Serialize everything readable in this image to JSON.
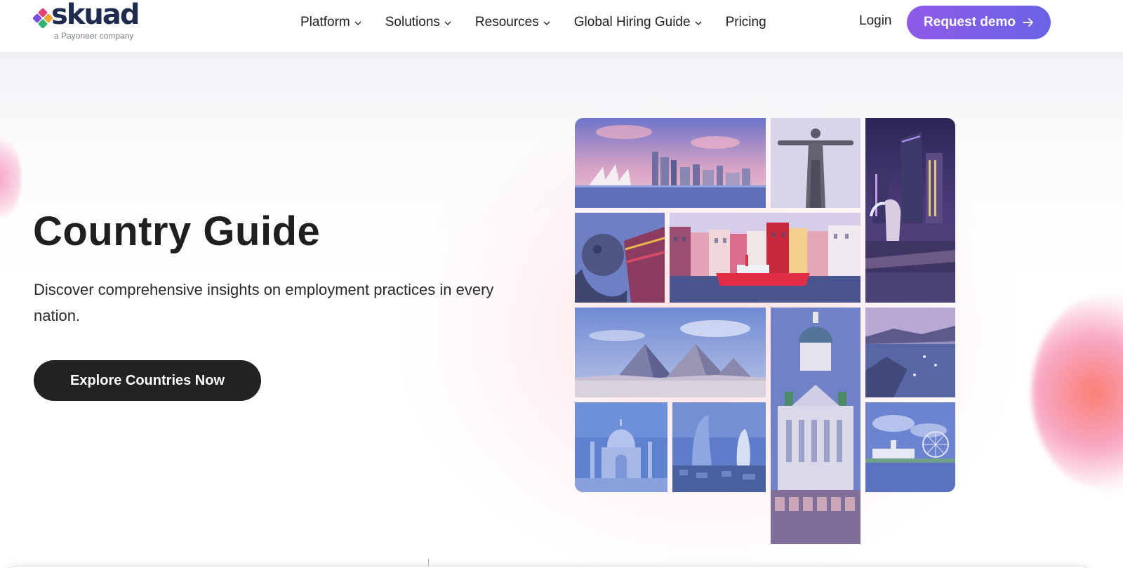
{
  "header": {
    "logo": {
      "word": "skuad",
      "sub": "a Payoneer company",
      "icon": "skuad-logo-icon"
    },
    "nav": [
      {
        "label": "Platform",
        "has_dropdown": true
      },
      {
        "label": "Solutions",
        "has_dropdown": true
      },
      {
        "label": "Resources",
        "has_dropdown": true
      },
      {
        "label": "Global Hiring Guide",
        "has_dropdown": true
      },
      {
        "label": "Pricing",
        "has_dropdown": false
      }
    ],
    "login_label": "Login",
    "demo_label": "Request demo",
    "demo_icon": "arrow-right-icon"
  },
  "hero": {
    "title": "Country Guide",
    "description": "Discover comprehensive insights on employment practices in every nation.",
    "cta_label": "Explore Countries Now"
  },
  "mosaic": {
    "tiles": [
      "sydney-opera-house-image",
      "christ-the-redeemer-image",
      "singapore-marina-merlion-image",
      "chinese-lion-statue-image",
      "copenhagen-nyhavn-image",
      "giza-pyramids-image",
      "helsinki-cathedral-image",
      "coastal-bay-image",
      "taj-mahal-image",
      "baku-flame-towers-image",
      "lakeside-ferris-wheel-image"
    ]
  },
  "colors": {
    "brand_navy": "#1e2b4f",
    "demo_gradient_start": "#8f5be8",
    "demo_gradient_end": "#6a63e6",
    "cta_dark": "#222222"
  }
}
